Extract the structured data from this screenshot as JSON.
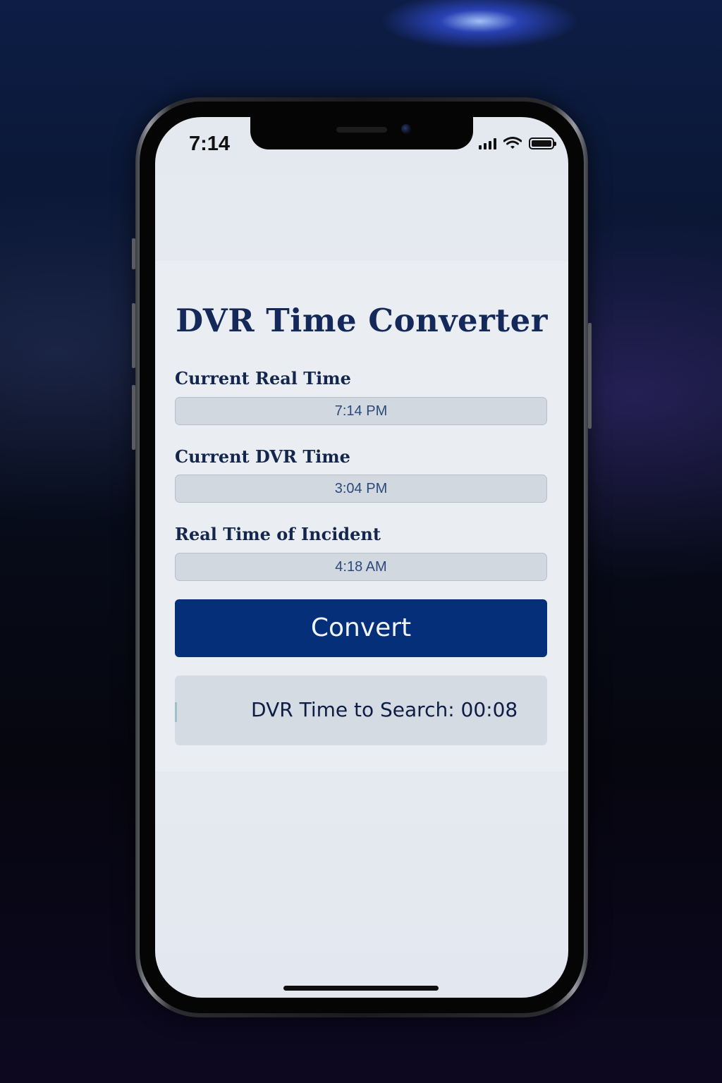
{
  "status_bar": {
    "time": "7:14",
    "icons": [
      "cellular-signal-icon",
      "wifi-icon",
      "battery-icon"
    ]
  },
  "app": {
    "title": "DVR Time Converter",
    "fields": [
      {
        "label": "Current Real Time",
        "value": "7:14 PM"
      },
      {
        "label": "Current DVR Time",
        "value": "3:04 PM"
      },
      {
        "label": "Real Time of Incident",
        "value": "4:18 AM"
      }
    ],
    "convert_label": "Convert",
    "result_text": "DVR Time to Search: 00:08"
  },
  "colors": {
    "accent": "#062f79",
    "title": "#14295a",
    "screen_background": "#e8ecf2"
  }
}
